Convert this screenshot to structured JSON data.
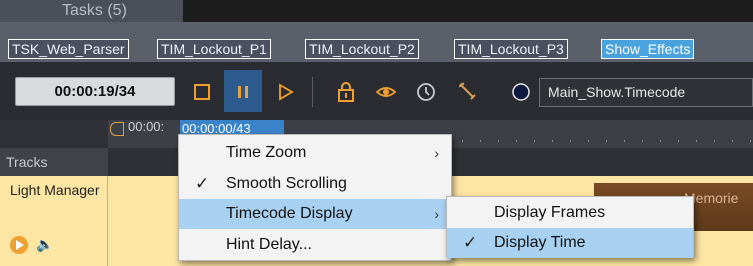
{
  "tasks": {
    "title": "Tasks (5)",
    "tabs": [
      {
        "label": "TSK_Web_Parser"
      },
      {
        "label": "TIM_Lockout_P1"
      },
      {
        "label": "TIM_Lockout_P2"
      },
      {
        "label": "TIM_Lockout_P3"
      },
      {
        "label": "Show_Effects"
      }
    ],
    "active_tab": "Show_Effects"
  },
  "toolbar": {
    "timecode": "00:00:19/34",
    "buttons": [
      "stop-icon",
      "pause-icon",
      "play-icon",
      "lock-icon",
      "eye-icon",
      "history-icon",
      "wrench-icon",
      "dark-circle-icon"
    ],
    "source": "Main_Show.Timecode"
  },
  "ruler": {
    "start_time": "00:00:",
    "current_time": "00:00:00/43"
  },
  "tracks": {
    "header": "Tracks",
    "items": [
      {
        "name": "Light Manager",
        "block_label": "Memorie"
      }
    ]
  },
  "context_menu": {
    "items": [
      {
        "label": "Time Zoom",
        "has_submenu": true,
        "checked": false,
        "highlighted": false
      },
      {
        "label": "Smooth Scrolling",
        "has_submenu": false,
        "checked": true,
        "highlighted": false
      },
      {
        "label": "Timecode Display",
        "has_submenu": true,
        "checked": false,
        "highlighted": true
      },
      {
        "label": "Hint Delay...",
        "has_submenu": false,
        "checked": false,
        "highlighted": false
      }
    ],
    "arrow_glyph": "›",
    "check_glyph": "✓"
  },
  "submenu": {
    "items": [
      {
        "label": "Display Frames",
        "checked": false,
        "highlighted": false
      },
      {
        "label": "Display Time",
        "checked": true,
        "highlighted": true
      }
    ]
  },
  "colors": {
    "accent": "#4aa3df",
    "menu_highlight": "#a8d0f0",
    "track_bg": "#fde5a3",
    "orange": "#f0a030"
  }
}
